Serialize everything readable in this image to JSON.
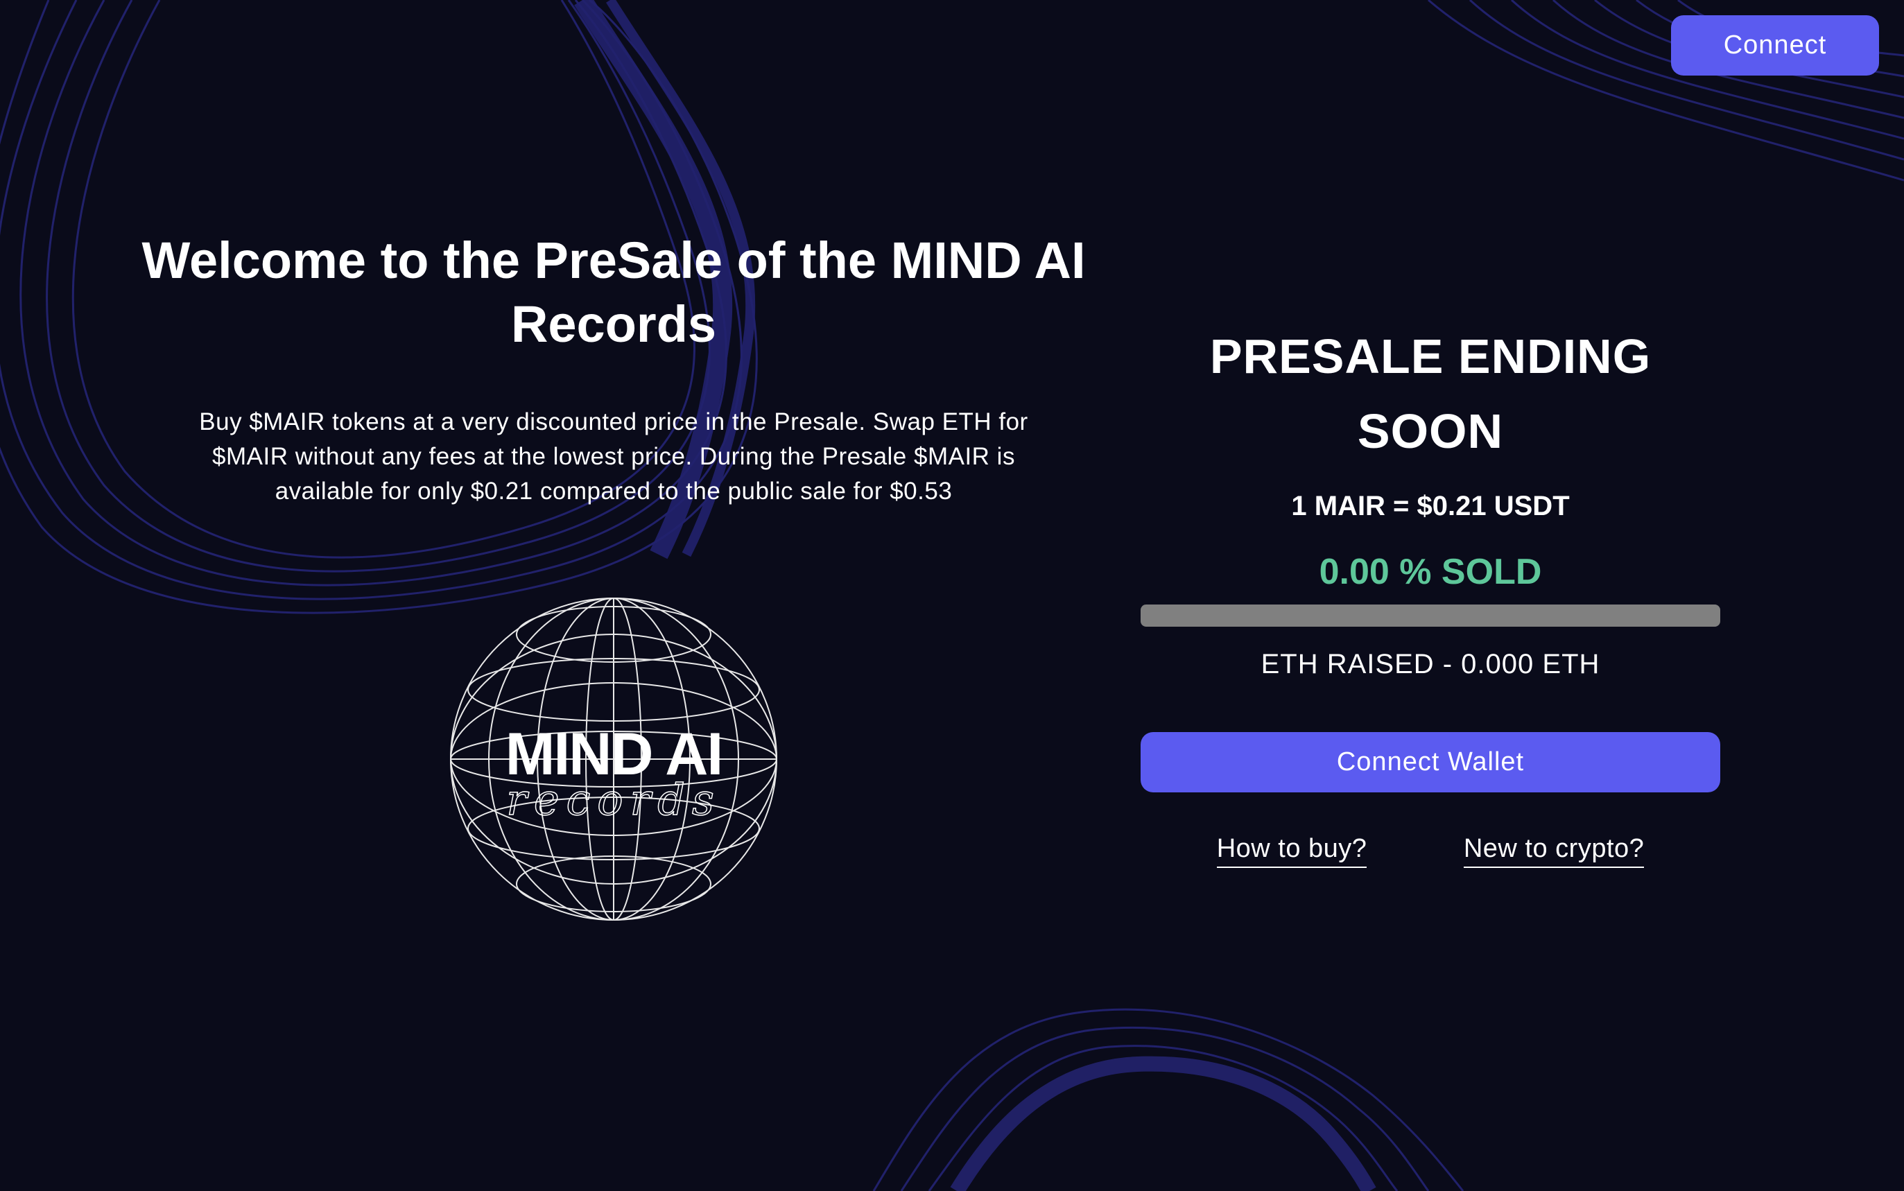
{
  "header": {
    "connect_label": "Connect"
  },
  "hero": {
    "title": "Welcome to the PreSale of the MIND AI Records",
    "description": "Buy $MAIR tokens at a very discounted price in the Presale. Swap ETH for $MAIR without any fees at the lowest price. During the Presale $MAIR is available for only $0.21 compared to the public sale for $0.53"
  },
  "logo": {
    "main_text": "MIND AI",
    "sub_text": "records"
  },
  "presale": {
    "heading": "PRESALE ENDING SOON",
    "rate": "1 MAIR = $0.21 USDT",
    "sold_label": "0.00 % SOLD",
    "sold_percent": 0,
    "raised": "ETH RAISED - 0.000 ETH",
    "connect_wallet_label": "Connect Wallet",
    "link_how_to_buy": "How to buy?",
    "link_new_to_crypto": "New to crypto?"
  },
  "colors": {
    "background": "#0a0b1a",
    "accent": "#5b5bf0",
    "sold_green": "#5ec79a",
    "progress_track": "#808080",
    "wave": "#2a2a7a"
  }
}
